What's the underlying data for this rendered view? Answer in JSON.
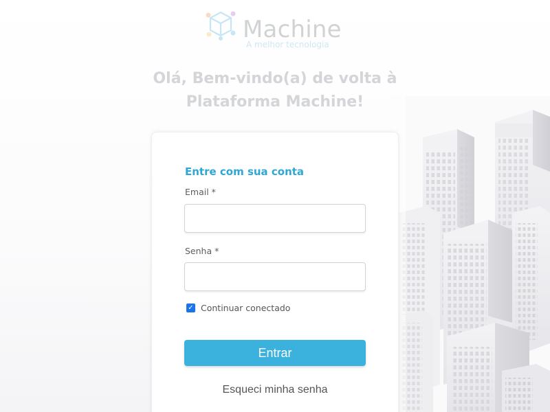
{
  "brand": {
    "name": "Machine",
    "tagline": "A melhor tecnologia",
    "logo_icon": "cube-network-icon"
  },
  "welcome": {
    "line1": "Olá, Bem-vindo(a) de volta à",
    "line2": "Plataforma Machine!"
  },
  "login": {
    "title": "Entre com sua conta",
    "email_label": "Email *",
    "email_value": "",
    "password_label": "Senha *",
    "password_value": "",
    "remember_label": "Continuar conectado",
    "remember_checked": true,
    "submit_label": "Entrar",
    "forgot_label": "Esqueci minha senha"
  },
  "colors": {
    "accent": "#2fa7d6",
    "button": "#3bb1dd",
    "checkbox": "#1a73e8"
  },
  "illustration": "city-buildings-illustration"
}
